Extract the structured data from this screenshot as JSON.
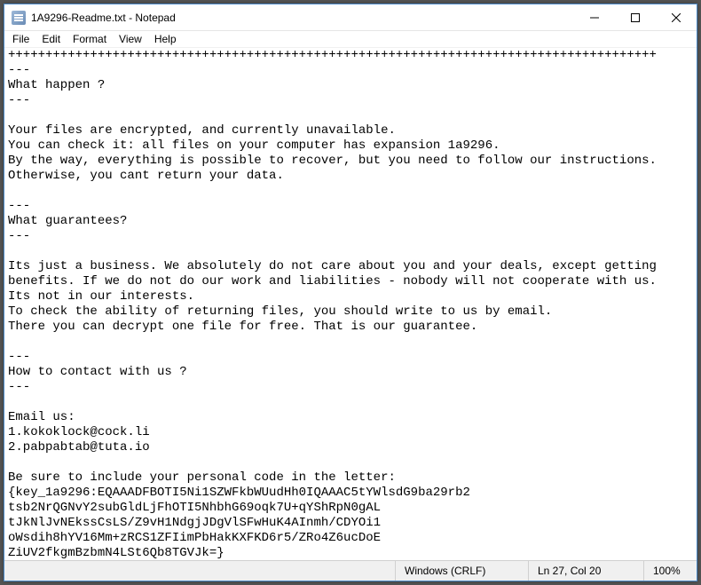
{
  "title": "1A9296-Readme.txt - Notepad",
  "menu": {
    "file": "File",
    "edit": "Edit",
    "format": "Format",
    "view": "View",
    "help": "Help"
  },
  "text": "+++++++++++++++++++++++++++++++++++++++++++++++++++++++++++++++++++++++++++++++++++++++\n---\nWhat happen ?\n---\n\nYour files are encrypted, and currently unavailable.\nYou can check it: all files on your computer has expansion 1a9296.\nBy the way, everything is possible to recover, but you need to follow our instructions.\nOtherwise, you cant return your data.\n\n---\nWhat guarantees?\n---\n\nIts just a business. We absolutely do not care about you and your deals, except getting\nbenefits. If we do not do our work and liabilities - nobody will not cooperate with us.\nIts not in our interests.\nTo check the ability of returning files, you should write to us by email.\nThere you can decrypt one file for free. That is our guarantee.\n\n---\nHow to contact with us ?\n---\n\nEmail us:\n1.kokoklock@cock.li\n2.pabpabtab@tuta.io\n\nBe sure to include your personal code in the letter:\n{key_1a9296:EQAAADFBOTI5Ni1SZWFkbWUudHh0IQAAAC5tYWlsdG9ba29rb2\ntsb2NrQGNvY2subGldLjFhOTI5NhbhG69oqk7U+qYShRpN0gAL\ntJkNlJvNEkssCsLS/Z9vH1NdgjJDgVlSFwHuK4AInmh/CDYOi1\noWsdih8hYV16Mm+zRCS1ZFIimPbHakKXFKD6r5/ZRo4Z6ucDoE\nZiUV2fkgmBzbmN4LSt6Qb8TGVJk=}",
  "status": {
    "encoding": "Windows (CRLF)",
    "position": "Ln 27, Col 20",
    "zoom": "100%"
  }
}
